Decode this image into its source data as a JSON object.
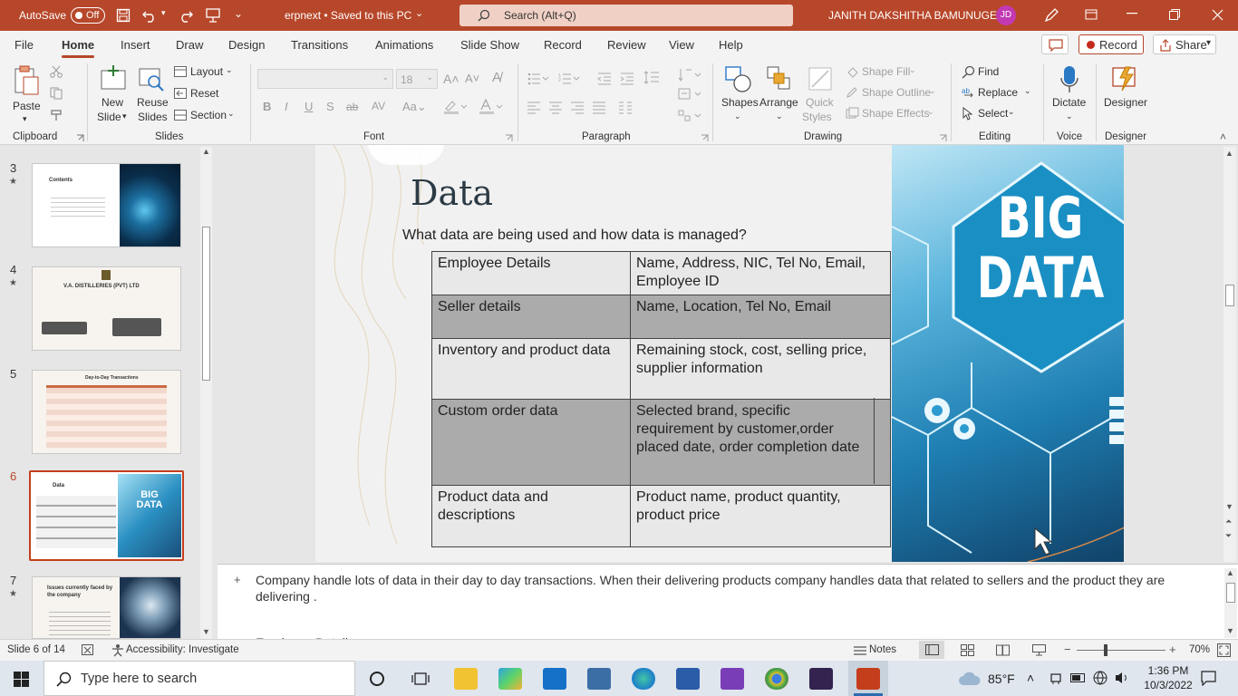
{
  "titlebar": {
    "autosave_label": "AutoSave",
    "autosave_state": "Off",
    "doc_title": "erpnext • Saved to this PC",
    "search_placeholder": "Search (Alt+Q)",
    "user_name": "JANITH DAKSHITHA BAMUNUGE",
    "user_initials": "JD",
    "accent": "#b7472a"
  },
  "tabs": [
    "File",
    "Home",
    "Insert",
    "Draw",
    "Design",
    "Transitions",
    "Animations",
    "Slide Show",
    "Record",
    "Review",
    "View",
    "Help"
  ],
  "tabs_right": {
    "record": "Record",
    "share": "Share"
  },
  "ribbon": {
    "clipboard": {
      "label": "Clipboard",
      "paste": "Paste"
    },
    "slides": {
      "label": "Slides",
      "new_slide_1": "New",
      "new_slide_2": "Slide",
      "reuse_1": "Reuse",
      "reuse_2": "Slides",
      "layout": "Layout",
      "reset": "Reset",
      "section": "Section"
    },
    "font": {
      "label": "Font",
      "font_size": "18"
    },
    "paragraph": {
      "label": "Paragraph"
    },
    "drawing": {
      "label": "Drawing",
      "shapes": "Shapes",
      "arrange": "Arrange",
      "quick_1": "Quick",
      "quick_2": "Styles",
      "fill": "Shape Fill",
      "outline": "Shape Outline",
      "effects": "Shape Effects"
    },
    "editing": {
      "label": "Editing",
      "find": "Find",
      "replace": "Replace",
      "select": "Select"
    },
    "voice": {
      "label": "Voice",
      "dictate": "Dictate"
    },
    "designer": {
      "label": "Designer",
      "designer": "Designer"
    }
  },
  "thumbnails": [
    {
      "num": "3",
      "star": "★",
      "title": "Contents"
    },
    {
      "num": "4",
      "star": "★",
      "title": "V.A. DISTILLERIES (PVT) LTD"
    },
    {
      "num": "5",
      "star": "",
      "title": "Day-to-Day Transactions"
    },
    {
      "num": "6",
      "star": "",
      "title": "Data",
      "art": "BIG DATA"
    },
    {
      "num": "7",
      "star": "★",
      "title": "Issues currently faced by the company"
    }
  ],
  "slide": {
    "title": "Data",
    "subtitle": "What data are being used and how data is managed?",
    "image_text_1": "BIG",
    "image_text_2": "DATA",
    "table": [
      {
        "left": "Employee Details",
        "right": "Name, Address, NIC, Tel No, Email, Employee ID"
      },
      {
        "left": "Seller details",
        "right": "Name, Location, Tel No, Email"
      },
      {
        "left": "Inventory and product data",
        "right": "Remaining stock, cost, selling price, supplier information"
      },
      {
        "left": "Custom order data",
        "right": "Selected brand, specific requirement by customer,order placed date, order completion date"
      },
      {
        "left": "Product data and descriptions",
        "right": "Product name, product quantity, product price"
      }
    ]
  },
  "notes": {
    "bullet_text": "Company handle lots of data in their day to day transactions. When their delivering products company handles data that related to sellers and the product they are delivering .",
    "next_line": "Employee Details"
  },
  "status": {
    "slide_info": "Slide 6 of 14",
    "accessibility": "Accessibility: Investigate",
    "notes": "Notes",
    "zoom": "70%"
  },
  "taskbar": {
    "search_placeholder": "Type here to search",
    "weather": "85°F",
    "time": "1:36 PM",
    "date": "10/3/2022"
  }
}
